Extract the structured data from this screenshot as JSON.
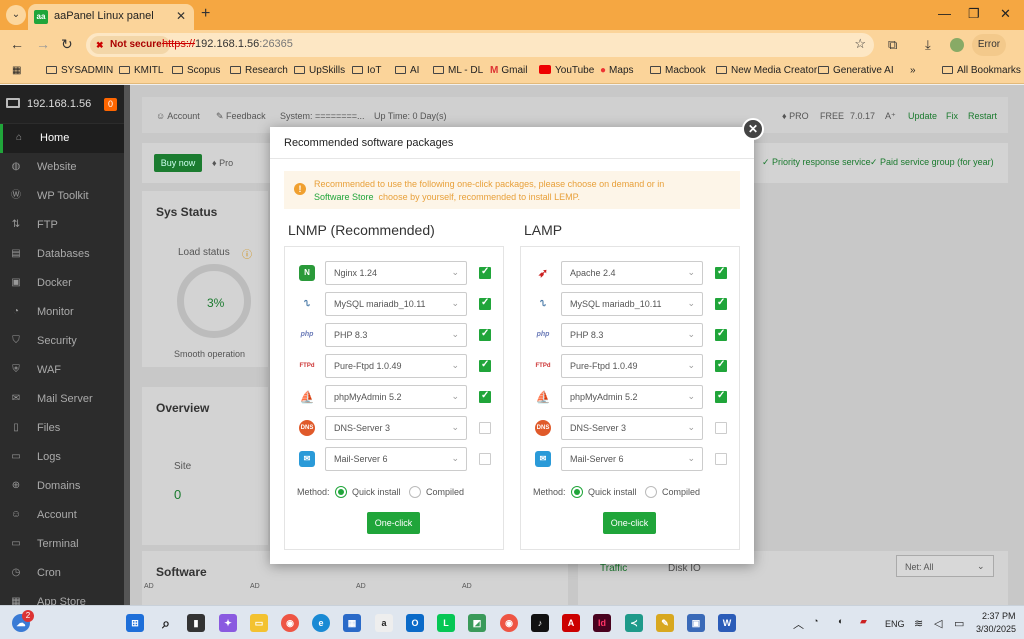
{
  "browser": {
    "tab_title": "aaPanel Linux panel",
    "tab_favicon": "aa",
    "security_label": "Not secure",
    "url_protocol": "https://",
    "url_host": "192.168.1.56",
    "url_port": ":26365",
    "error_label": "Error",
    "bookmarks": [
      "SYSADMIN",
      "KMITL",
      "Scopus",
      "Research",
      "UpSkills",
      "IoT",
      "AI",
      "ML - DL",
      "Gmail",
      "YouTube",
      "Maps",
      "Macbook",
      "New Media Creator",
      "Generative AI",
      "All Bookmarks"
    ]
  },
  "sidebar": {
    "host": "192.168.1.56",
    "badge": "0",
    "items": [
      "Home",
      "Website",
      "WP Toolkit",
      "FTP",
      "Databases",
      "Docker",
      "Monitor",
      "Security",
      "WAF",
      "Mail Server",
      "Files",
      "Logs",
      "Domains",
      "Account",
      "Terminal",
      "Cron",
      "App Store"
    ],
    "active": "Home"
  },
  "topinfo": {
    "account": "Account",
    "feedback": "Feedback",
    "system": "System: ========...",
    "uptime": "Up Time: 0 Day(s)",
    "pro": "PRO",
    "free": "FREE",
    "version": "7.0.17",
    "update": "Update",
    "fix": "Fix",
    "restart": "Restart"
  },
  "bg": {
    "buy_now": "Buy now",
    "pro": "Pro",
    "priority": "Priority response service",
    "paid_group": "Paid service group (for year)",
    "sys_status": "Sys Status",
    "load_status": "Load status",
    "load_value": "3%",
    "smooth": "Smooth operation",
    "overview": "Overview",
    "site": "Site",
    "site_count": "0",
    "software": "Software",
    "traffic": "Traffic",
    "disk_io": "Disk IO",
    "net": "Net: All",
    "ad": "AD"
  },
  "modal": {
    "title": "Recommended software packages",
    "notice_line1": "Recommended to use the following one-click packages, please choose on demand or in",
    "notice_link": "Software Store",
    "notice_line2": "choose by yourself, recommended to install LEMP.",
    "lnmp": {
      "title": "LNMP (Recommended)",
      "rows": [
        {
          "icon": "nginx-icon",
          "value": "Nginx 1.24",
          "checked": true
        },
        {
          "icon": "mysql-icon",
          "value": "MySQL mariadb_10.11",
          "checked": true
        },
        {
          "icon": "php-icon",
          "value": "PHP 8.3",
          "checked": true
        },
        {
          "icon": "ftp-icon",
          "value": "Pure-Ftpd 1.0.49",
          "checked": true
        },
        {
          "icon": "phpmyadmin-icon",
          "value": "phpMyAdmin 5.2",
          "checked": true
        },
        {
          "icon": "dns-icon",
          "value": "DNS-Server 3",
          "checked": false
        },
        {
          "icon": "mail-icon",
          "value": "Mail-Server 6",
          "checked": false
        }
      ]
    },
    "lamp": {
      "title": "LAMP",
      "rows": [
        {
          "icon": "apache-icon",
          "value": "Apache 2.4",
          "checked": true
        },
        {
          "icon": "mysql-icon",
          "value": "MySQL mariadb_10.11",
          "checked": true
        },
        {
          "icon": "php-icon",
          "value": "PHP 8.3",
          "checked": true
        },
        {
          "icon": "ftp-icon",
          "value": "Pure-Ftpd 1.0.49",
          "checked": true
        },
        {
          "icon": "phpmyadmin-icon",
          "value": "phpMyAdmin 5.2",
          "checked": true
        },
        {
          "icon": "dns-icon",
          "value": "DNS-Server 3",
          "checked": false
        },
        {
          "icon": "mail-icon",
          "value": "Mail-Server 6",
          "checked": false
        }
      ]
    },
    "method_label": "Method:",
    "quick_install": "Quick install",
    "compiled": "Compiled",
    "one_click": "One-click"
  },
  "taskbar": {
    "notif_count": "2",
    "lang": "ENG",
    "time": "2:37 PM",
    "date": "3/30/2025"
  },
  "colors": {
    "accent": "#20a53a",
    "tab_bar": "#f5a742",
    "notice_text": "#e8a03a"
  }
}
